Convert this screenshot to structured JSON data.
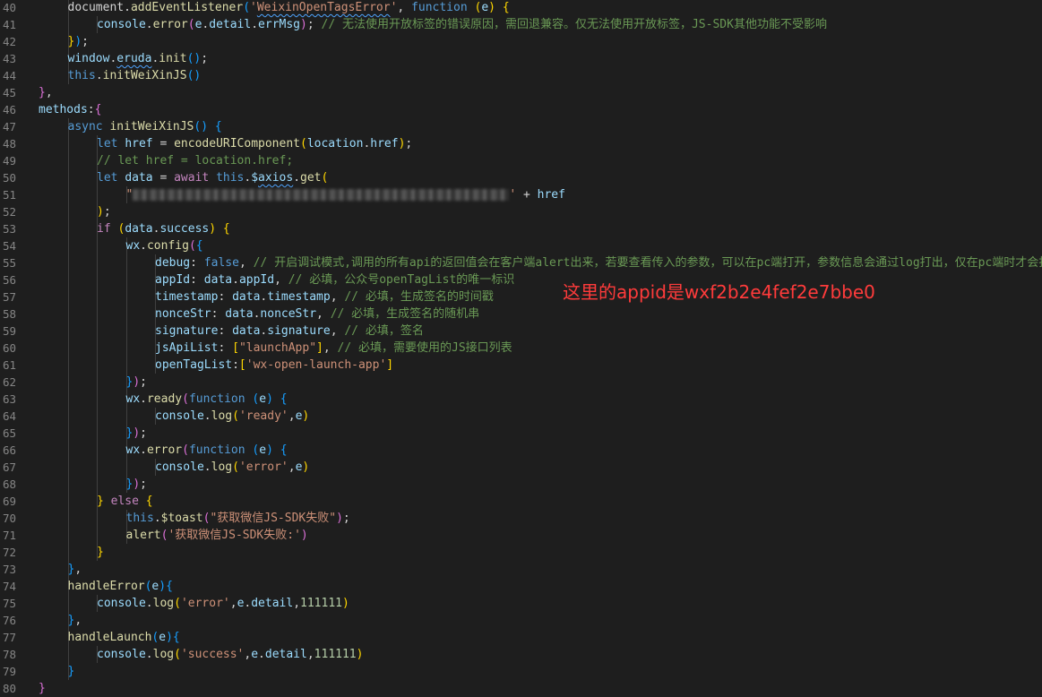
{
  "editor": {
    "language": "javascript",
    "colors": {
      "background": "#1e1e1e",
      "keyword": "#569cd6",
      "control_keyword": "#c586c0",
      "function": "#dcdcaa",
      "property": "#9cdcfe",
      "string": "#ce9178",
      "comment": "#6a9955",
      "number": "#b5cea8",
      "line_number": "#858585",
      "annotation": "#ff3b3b"
    },
    "lines": [
      {
        "n": "40",
        "ind": 2,
        "tok": [
          [
            "p",
            "document."
          ],
          [
            "fn",
            "addEventListener"
          ],
          [
            "br3",
            "("
          ],
          [
            "str",
            "'"
          ],
          [
            "strsq",
            "WeixinOpenTagsError"
          ],
          [
            "str",
            "'"
          ],
          [
            "p",
            ", "
          ],
          [
            "kw",
            "function"
          ],
          [
            "p",
            " "
          ],
          [
            "br1",
            "("
          ],
          [
            "prop",
            "e"
          ],
          [
            "br1",
            ")"
          ],
          [
            "p",
            " "
          ],
          [
            "br1",
            "{"
          ]
        ]
      },
      {
        "n": "41",
        "ind": 3,
        "tok": [
          [
            "prop",
            "console"
          ],
          [
            "p",
            "."
          ],
          [
            "fn",
            "error"
          ],
          [
            "br2",
            "("
          ],
          [
            "prop",
            "e"
          ],
          [
            "p",
            "."
          ],
          [
            "prop",
            "detail"
          ],
          [
            "p",
            "."
          ],
          [
            "prop",
            "errMsg"
          ],
          [
            "br2",
            ")"
          ],
          [
            "p",
            "; "
          ],
          [
            "com",
            "// 无法使用开放标签的错误原因，需回退兼容。仅无法使用开放标签，JS-SDK其他功能不受影响"
          ]
        ]
      },
      {
        "n": "42",
        "ind": 2,
        "tok": [
          [
            "br1",
            "}"
          ],
          [
            "br3",
            ")"
          ],
          [
            "p",
            ";"
          ]
        ]
      },
      {
        "n": "43",
        "ind": 2,
        "tok": [
          [
            "prop",
            "window"
          ],
          [
            "p",
            "."
          ],
          [
            "propsq",
            "eruda"
          ],
          [
            "p",
            "."
          ],
          [
            "fn",
            "init"
          ],
          [
            "br3",
            "()"
          ],
          [
            "p",
            ";"
          ]
        ]
      },
      {
        "n": "44",
        "ind": 2,
        "tok": [
          [
            "kw",
            "this"
          ],
          [
            "p",
            "."
          ],
          [
            "fn",
            "initWeiXinJS"
          ],
          [
            "br3",
            "()"
          ]
        ]
      },
      {
        "n": "45",
        "ind": 1,
        "tok": [
          [
            "br2",
            "}"
          ],
          [
            "p",
            ","
          ]
        ]
      },
      {
        "n": "46",
        "ind": 1,
        "tok": [
          [
            "prop",
            "methods"
          ],
          [
            "p",
            ":"
          ],
          [
            "br2",
            "{"
          ]
        ]
      },
      {
        "n": "47",
        "ind": 2,
        "tok": [
          [
            "kw",
            "async"
          ],
          [
            "p",
            " "
          ],
          [
            "fn",
            "initWeiXinJS"
          ],
          [
            "br3",
            "()"
          ],
          [
            "p",
            " "
          ],
          [
            "br3",
            "{"
          ]
        ]
      },
      {
        "n": "48",
        "ind": 3,
        "tok": [
          [
            "kw",
            "let"
          ],
          [
            "p",
            " "
          ],
          [
            "prop",
            "href"
          ],
          [
            "p",
            " = "
          ],
          [
            "fn",
            "encodeURIComponent"
          ],
          [
            "br1",
            "("
          ],
          [
            "prop",
            "location"
          ],
          [
            "p",
            "."
          ],
          [
            "prop",
            "href"
          ],
          [
            "br1",
            ")"
          ],
          [
            "p",
            ";"
          ]
        ]
      },
      {
        "n": "49",
        "ind": 3,
        "tok": [
          [
            "com",
            "// let href = location.href;"
          ]
        ]
      },
      {
        "n": "50",
        "ind": 3,
        "tok": [
          [
            "kw",
            "let"
          ],
          [
            "p",
            " "
          ],
          [
            "prop",
            "data"
          ],
          [
            "p",
            " = "
          ],
          [
            "kw2",
            "await"
          ],
          [
            "p",
            " "
          ],
          [
            "kw",
            "this"
          ],
          [
            "p",
            "."
          ],
          [
            "prop",
            "$"
          ],
          [
            "propsq",
            "axios"
          ],
          [
            "p",
            "."
          ],
          [
            "fn",
            "get"
          ],
          [
            "br1",
            "("
          ]
        ]
      },
      {
        "n": "51",
        "ind": 4,
        "tok": [
          [
            "str",
            "\""
          ],
          [
            "blur",
            "blurred"
          ],
          [
            "str",
            "'"
          ],
          [
            "p",
            " + "
          ],
          [
            "prop",
            "href"
          ]
        ]
      },
      {
        "n": "52",
        "ind": 3,
        "tok": [
          [
            "br1",
            ")"
          ],
          [
            "p",
            ";"
          ]
        ]
      },
      {
        "n": "53",
        "ind": 3,
        "tok": [
          [
            "kw2",
            "if"
          ],
          [
            "p",
            " "
          ],
          [
            "br1",
            "("
          ],
          [
            "prop",
            "data"
          ],
          [
            "p",
            "."
          ],
          [
            "prop",
            "success"
          ],
          [
            "br1",
            ")"
          ],
          [
            "p",
            " "
          ],
          [
            "br1",
            "{"
          ]
        ]
      },
      {
        "n": "54",
        "ind": 4,
        "tok": [
          [
            "prop",
            "wx"
          ],
          [
            "p",
            "."
          ],
          [
            "fn",
            "config"
          ],
          [
            "br2",
            "("
          ],
          [
            "br3",
            "{"
          ]
        ]
      },
      {
        "n": "55",
        "ind": 5,
        "tok": [
          [
            "prop",
            "debug"
          ],
          [
            "p",
            ": "
          ],
          [
            "kw",
            "false"
          ],
          [
            "p",
            ", "
          ],
          [
            "com",
            "// 开启调试模式,调用的所有api的返回值会在客户端alert出来，若要查看传入的参数，可以在pc端打开，参数信息会通过log打出，仅在pc端时才会打印。"
          ]
        ]
      },
      {
        "n": "56",
        "ind": 5,
        "tok": [
          [
            "prop",
            "appId"
          ],
          [
            "p",
            ": "
          ],
          [
            "prop",
            "data"
          ],
          [
            "p",
            "."
          ],
          [
            "prop",
            "appId"
          ],
          [
            "p",
            ", "
          ],
          [
            "com",
            "// 必填，公众号openTagList的唯一标识"
          ]
        ]
      },
      {
        "n": "57",
        "ind": 5,
        "tok": [
          [
            "prop",
            "timestamp"
          ],
          [
            "p",
            ": "
          ],
          [
            "prop",
            "data"
          ],
          [
            "p",
            "."
          ],
          [
            "prop",
            "timestamp"
          ],
          [
            "p",
            ", "
          ],
          [
            "com",
            "// 必填，生成签名的时间戳"
          ]
        ]
      },
      {
        "n": "58",
        "ind": 5,
        "tok": [
          [
            "prop",
            "nonceStr"
          ],
          [
            "p",
            ": "
          ],
          [
            "prop",
            "data"
          ],
          [
            "p",
            "."
          ],
          [
            "prop",
            "nonceStr"
          ],
          [
            "p",
            ", "
          ],
          [
            "com",
            "// 必填，生成签名的随机串"
          ]
        ]
      },
      {
        "n": "59",
        "ind": 5,
        "tok": [
          [
            "prop",
            "signature"
          ],
          [
            "p",
            ": "
          ],
          [
            "prop",
            "data"
          ],
          [
            "p",
            "."
          ],
          [
            "prop",
            "signature"
          ],
          [
            "p",
            ", "
          ],
          [
            "com",
            "// 必填，签名"
          ]
        ]
      },
      {
        "n": "60",
        "ind": 5,
        "tok": [
          [
            "prop",
            "jsApiList"
          ],
          [
            "p",
            ": "
          ],
          [
            "br1",
            "["
          ],
          [
            "str",
            "\"launchApp\""
          ],
          [
            "br1",
            "]"
          ],
          [
            "p",
            ", "
          ],
          [
            "com",
            "// 必填，需要使用的JS接口列表"
          ]
        ]
      },
      {
        "n": "61",
        "ind": 5,
        "tok": [
          [
            "prop",
            "openTagList"
          ],
          [
            "p",
            ":"
          ],
          [
            "br1",
            "["
          ],
          [
            "str",
            "'wx-open-launch-app'"
          ],
          [
            "br1",
            "]"
          ]
        ]
      },
      {
        "n": "62",
        "ind": 4,
        "tok": [
          [
            "br3",
            "}"
          ],
          [
            "br2",
            ")"
          ],
          [
            "p",
            ";"
          ]
        ]
      },
      {
        "n": "63",
        "ind": 4,
        "tok": [
          [
            "prop",
            "wx"
          ],
          [
            "p",
            "."
          ],
          [
            "fn",
            "ready"
          ],
          [
            "br2",
            "("
          ],
          [
            "kw",
            "function"
          ],
          [
            "p",
            " "
          ],
          [
            "br3",
            "("
          ],
          [
            "prop",
            "e"
          ],
          [
            "br3",
            ")"
          ],
          [
            "p",
            " "
          ],
          [
            "br3",
            "{"
          ]
        ]
      },
      {
        "n": "64",
        "ind": 5,
        "tok": [
          [
            "prop",
            "console"
          ],
          [
            "p",
            "."
          ],
          [
            "fn",
            "log"
          ],
          [
            "br1",
            "("
          ],
          [
            "str",
            "'ready'"
          ],
          [
            "p",
            ","
          ],
          [
            "prop",
            "e"
          ],
          [
            "br1",
            ")"
          ]
        ]
      },
      {
        "n": "65",
        "ind": 4,
        "tok": [
          [
            "br3",
            "}"
          ],
          [
            "br2",
            ")"
          ],
          [
            "p",
            ";"
          ]
        ]
      },
      {
        "n": "66",
        "ind": 4,
        "tok": [
          [
            "prop",
            "wx"
          ],
          [
            "p",
            "."
          ],
          [
            "fn",
            "error"
          ],
          [
            "br2",
            "("
          ],
          [
            "kw",
            "function"
          ],
          [
            "p",
            " "
          ],
          [
            "br3",
            "("
          ],
          [
            "prop",
            "e"
          ],
          [
            "br3",
            ")"
          ],
          [
            "p",
            " "
          ],
          [
            "br3",
            "{"
          ]
        ]
      },
      {
        "n": "67",
        "ind": 5,
        "tok": [
          [
            "prop",
            "console"
          ],
          [
            "p",
            "."
          ],
          [
            "fn",
            "log"
          ],
          [
            "br1",
            "("
          ],
          [
            "str",
            "'error'"
          ],
          [
            "p",
            ","
          ],
          [
            "prop",
            "e"
          ],
          [
            "br1",
            ")"
          ]
        ]
      },
      {
        "n": "68",
        "ind": 4,
        "tok": [
          [
            "br3",
            "}"
          ],
          [
            "br2",
            ")"
          ],
          [
            "p",
            ";"
          ]
        ]
      },
      {
        "n": "69",
        "ind": 3,
        "tok": [
          [
            "br1",
            "}"
          ],
          [
            "p",
            " "
          ],
          [
            "kw2",
            "else"
          ],
          [
            "p",
            " "
          ],
          [
            "br1",
            "{"
          ]
        ]
      },
      {
        "n": "70",
        "ind": 4,
        "tok": [
          [
            "kw",
            "this"
          ],
          [
            "p",
            "."
          ],
          [
            "fn",
            "$toast"
          ],
          [
            "br2",
            "("
          ],
          [
            "str",
            "\"获取微信JS-SDK失败\""
          ],
          [
            "br2",
            ")"
          ],
          [
            "p",
            ";"
          ]
        ]
      },
      {
        "n": "71",
        "ind": 4,
        "tok": [
          [
            "fn",
            "alert"
          ],
          [
            "br2",
            "("
          ],
          [
            "str",
            "'获取微信JS-SDK失败:'"
          ],
          [
            "br2",
            ")"
          ]
        ]
      },
      {
        "n": "72",
        "ind": 3,
        "tok": [
          [
            "br1",
            "}"
          ]
        ]
      },
      {
        "n": "73",
        "ind": 2,
        "tok": [
          [
            "br3",
            "}"
          ],
          [
            "p",
            ","
          ]
        ]
      },
      {
        "n": "74",
        "ind": 2,
        "tok": [
          [
            "fn",
            "handleError"
          ],
          [
            "br3",
            "("
          ],
          [
            "prop",
            "e"
          ],
          [
            "br3",
            ")"
          ],
          [
            "br3",
            "{"
          ]
        ]
      },
      {
        "n": "75",
        "ind": 3,
        "tok": [
          [
            "prop",
            "console"
          ],
          [
            "p",
            "."
          ],
          [
            "fn",
            "log"
          ],
          [
            "br1",
            "("
          ],
          [
            "str",
            "'error'"
          ],
          [
            "p",
            ","
          ],
          [
            "prop",
            "e"
          ],
          [
            "p",
            "."
          ],
          [
            "prop",
            "detail"
          ],
          [
            "p",
            ","
          ],
          [
            "num",
            "111111"
          ],
          [
            "br1",
            ")"
          ]
        ]
      },
      {
        "n": "76",
        "ind": 2,
        "tok": [
          [
            "br3",
            "}"
          ],
          [
            "p",
            ","
          ]
        ]
      },
      {
        "n": "77",
        "ind": 2,
        "tok": [
          [
            "fn",
            "handleLaunch"
          ],
          [
            "br3",
            "("
          ],
          [
            "prop",
            "e"
          ],
          [
            "br3",
            ")"
          ],
          [
            "br3",
            "{"
          ]
        ]
      },
      {
        "n": "78",
        "ind": 3,
        "tok": [
          [
            "prop",
            "console"
          ],
          [
            "p",
            "."
          ],
          [
            "fn",
            "log"
          ],
          [
            "br1",
            "("
          ],
          [
            "str",
            "'success'"
          ],
          [
            "p",
            ","
          ],
          [
            "prop",
            "e"
          ],
          [
            "p",
            "."
          ],
          [
            "prop",
            "detail"
          ],
          [
            "p",
            ","
          ],
          [
            "num",
            "111111"
          ],
          [
            "br1",
            ")"
          ]
        ]
      },
      {
        "n": "79",
        "ind": 2,
        "tok": [
          [
            "br3",
            "}"
          ]
        ]
      },
      {
        "n": "80",
        "ind": 1,
        "tok": [
          [
            "br2",
            "}"
          ]
        ]
      }
    ]
  },
  "annotation": {
    "text": "这里的appid是wxf2b2e4fef2e7bbe0"
  }
}
